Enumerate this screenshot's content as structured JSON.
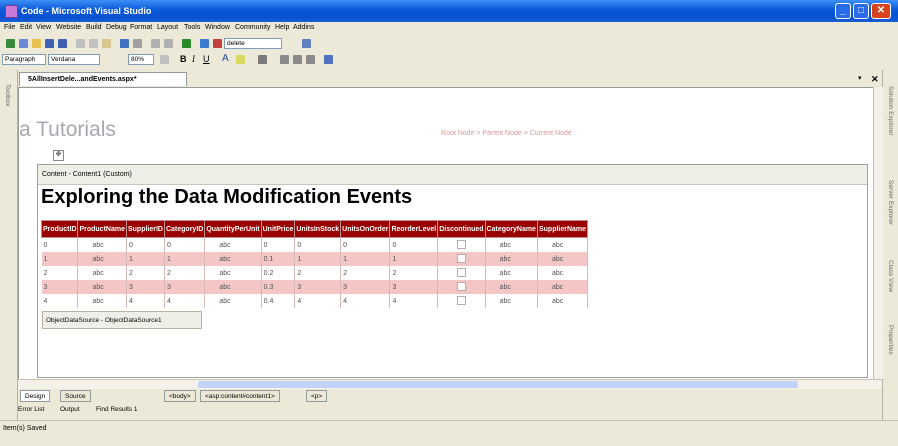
{
  "window": {
    "title": "Code - Microsoft Visual Studio"
  },
  "menu": [
    "File",
    "Edit",
    "View",
    "Website",
    "Build",
    "Debug",
    "Format",
    "Layout",
    "Tools",
    "Window",
    "Community",
    "Help",
    "Addins"
  ],
  "toolbar": {
    "search_value": "delete"
  },
  "format_toolbar": {
    "block_format": "Paragraph",
    "font_name": "Verdana",
    "zoom": "80%"
  },
  "document_tab": {
    "label": "5AllInsertDele...andEvents.aspx*"
  },
  "page": {
    "header_text": "a Tutorials",
    "sitemap": "Root Node > Parent Node > Current Node",
    "content_label": "Content - Content1 (Custom)",
    "heading": "Exploring the Data Modification Events",
    "ods_label": "ObjectDataSource - ObjectDataSource1"
  },
  "grid": {
    "columns": [
      "ProductID",
      "ProductName",
      "SupplierID",
      "CategoryID",
      "QuantityPerUnit",
      "UnitPrice",
      "UnitsInStock",
      "UnitsOnOrder",
      "ReorderLevel",
      "Discontinued",
      "CategoryName",
      "SupplierName"
    ],
    "rows": [
      [
        "0",
        "abc",
        "0",
        "0",
        "abc",
        "0",
        "0",
        "0",
        "0",
        "",
        "abc",
        "abc"
      ],
      [
        "1",
        "abc",
        "1",
        "1",
        "abc",
        "0.1",
        "1",
        "1",
        "1",
        "",
        "abc",
        "abc"
      ],
      [
        "2",
        "abc",
        "2",
        "2",
        "abc",
        "0.2",
        "2",
        "2",
        "2",
        "",
        "abc",
        "abc"
      ],
      [
        "3",
        "abc",
        "3",
        "3",
        "abc",
        "0.3",
        "3",
        "3",
        "3",
        "",
        "abc",
        "abc"
      ],
      [
        "4",
        "abc",
        "4",
        "4",
        "abc",
        "0.4",
        "4",
        "4",
        "4",
        "",
        "abc",
        "abc"
      ]
    ]
  },
  "viewbar": {
    "design": "Design",
    "source": "Source",
    "crumbs": [
      "<body>",
      "<asp:content#content1>",
      "<p>"
    ]
  },
  "output_tabs": [
    "Error List",
    "Output",
    "Find Results 1"
  ],
  "right_dock": [
    "Solution Explorer",
    "Server Explorer",
    "Class View",
    "Properties"
  ],
  "left_dock": "Toolbox",
  "status": "Item(s) Saved",
  "colors": {
    "grid_header": "#990000",
    "alt_row": "#f5c6c6",
    "title_bar": "#0a58d8"
  }
}
